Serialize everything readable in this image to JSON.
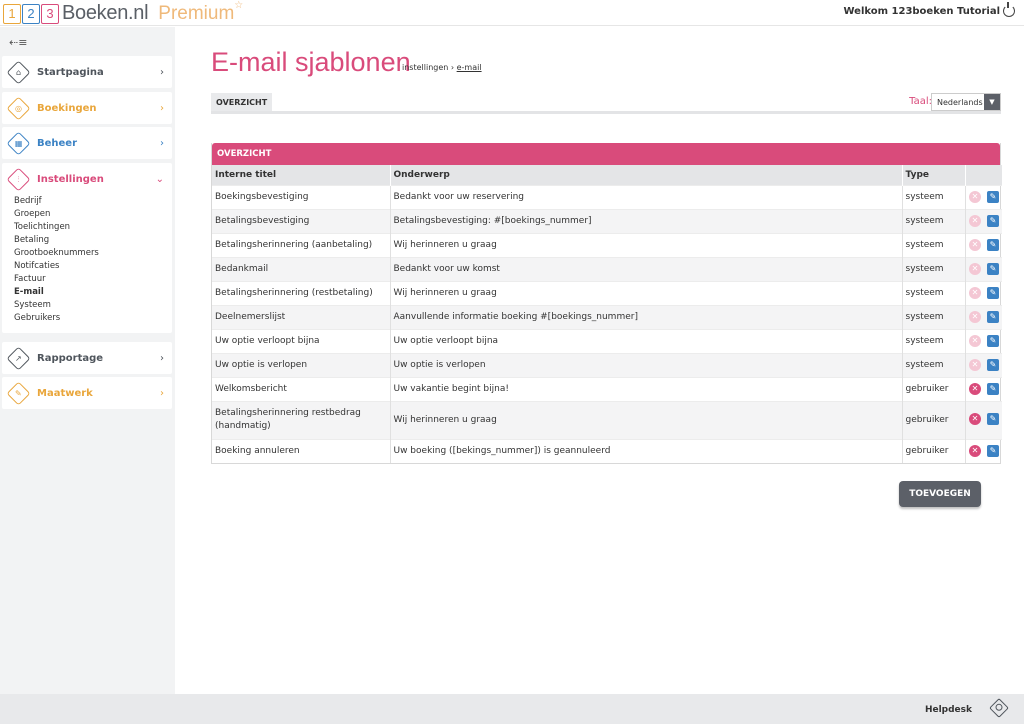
{
  "header": {
    "logo_digits": [
      "1",
      "2",
      "3"
    ],
    "brand": "Boeken.nl",
    "premium": "Premium",
    "premium_star": "☆",
    "welcome": "Welkom 123boeken Tutorial"
  },
  "sidebar": {
    "toggle_icon": "menu-collapse-icon",
    "items": [
      {
        "label": "Startpagina",
        "icon": "home-icon",
        "color": "#4f555c"
      },
      {
        "label": "Boekingen",
        "icon": "bookings-icon",
        "color": "#e9a63b"
      },
      {
        "label": "Beheer",
        "icon": "manage-icon",
        "color": "#3b82c4"
      },
      {
        "label": "Instellingen",
        "icon": "settings-icon",
        "color": "#d94b7b"
      },
      {
        "label": "Rapportage",
        "icon": "chart-icon",
        "color": "#4f555c"
      },
      {
        "label": "Maatwerk",
        "icon": "custom-icon",
        "color": "#e9a63b"
      }
    ],
    "settings_sub": [
      "Bedrijf",
      "Groepen",
      "Toelichtingen",
      "Betaling",
      "Grootboeknummers",
      "Notifcaties",
      "Factuur",
      "E-mail",
      "Systeem",
      "Gebruikers"
    ],
    "settings_active": "E-mail"
  },
  "main": {
    "title": "E-mail sjablonen",
    "breadcrumb": {
      "parent": "instellingen",
      "sep": "›",
      "current": "e-mail"
    },
    "tab": "OVERZICHT",
    "language": {
      "label": "Taal:",
      "value": "Nederlands"
    },
    "panel_title": "OVERZICHT",
    "columns": [
      "Interne titel",
      "Onderwerp",
      "Type"
    ],
    "rows": [
      {
        "title": "Boekingsbevestiging",
        "subject": "Bedankt voor uw reservering",
        "type": "systeem"
      },
      {
        "title": "Betalingsbevestiging",
        "subject": "Betalingsbevestiging: #[boekings_nummer]",
        "type": "systeem"
      },
      {
        "title": "Betalingsherinnering (aanbetaling)",
        "subject": "Wij herinneren u graag",
        "type": "systeem"
      },
      {
        "title": "Bedankmail",
        "subject": "Bedankt voor uw komst",
        "type": "systeem"
      },
      {
        "title": "Betalingsherinnering (restbetaling)",
        "subject": "Wij herinneren u graag",
        "type": "systeem"
      },
      {
        "title": "Deelnemerslijst",
        "subject": "Aanvullende informatie boeking #[boekings_nummer]",
        "type": "systeem"
      },
      {
        "title": "Uw optie verloopt bijna",
        "subject": "Uw optie verloopt bijna",
        "type": "systeem"
      },
      {
        "title": "Uw optie is verlopen",
        "subject": "Uw optie is verlopen",
        "type": "systeem"
      },
      {
        "title": "Welkomsbericht",
        "subject": "Uw vakantie begint bijna!",
        "type": "gebruiker"
      },
      {
        "title": "Betalingsherinnering restbedrag (handmatig)",
        "subject": "Wij herinneren u graag",
        "type": "gebruiker"
      },
      {
        "title": "Boeking annuleren",
        "subject": "Uw boeking ([bekings_nummer]) is geannuleerd",
        "type": "gebruiker"
      }
    ],
    "add_button": "TOEVOEGEN"
  },
  "footer": {
    "helpdesk": "Helpdesk"
  }
}
